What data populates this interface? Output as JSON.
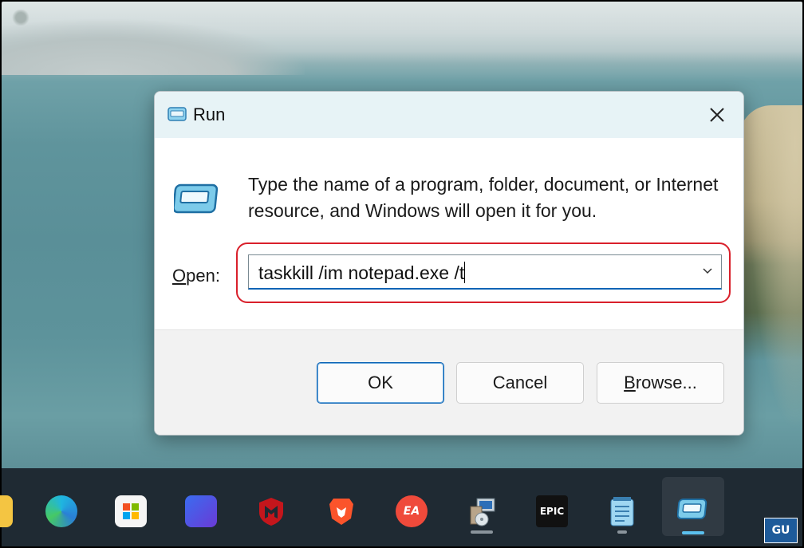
{
  "dialog": {
    "title": "Run",
    "description": "Type the name of a program, folder, document, or Internet resource, and Windows will open it for you.",
    "open_label_prefix": "",
    "open_label_accel": "O",
    "open_label_rest": "pen:",
    "open_value": "taskkill /im notepad.exe /t",
    "buttons": {
      "ok": "OK",
      "cancel": "Cancel",
      "browse_accel": "B",
      "browse_rest": "rowse..."
    },
    "highlight_color": "#d9202b",
    "accent_color": "#0a63b5"
  },
  "taskbar": {
    "items": [
      {
        "name": "file-explorer-icon"
      },
      {
        "name": "edge-icon"
      },
      {
        "name": "microsoft-store-icon"
      },
      {
        "name": "app-ma-icon"
      },
      {
        "name": "mcafee-icon"
      },
      {
        "name": "brave-icon"
      },
      {
        "name": "ea-icon",
        "label": "EA"
      },
      {
        "name": "setup-program-icon"
      },
      {
        "name": "epic-games-icon",
        "label": "EPIC"
      },
      {
        "name": "notepad-icon"
      },
      {
        "name": "run-icon",
        "active": true
      }
    ]
  },
  "watermark": {
    "text": "GU"
  }
}
